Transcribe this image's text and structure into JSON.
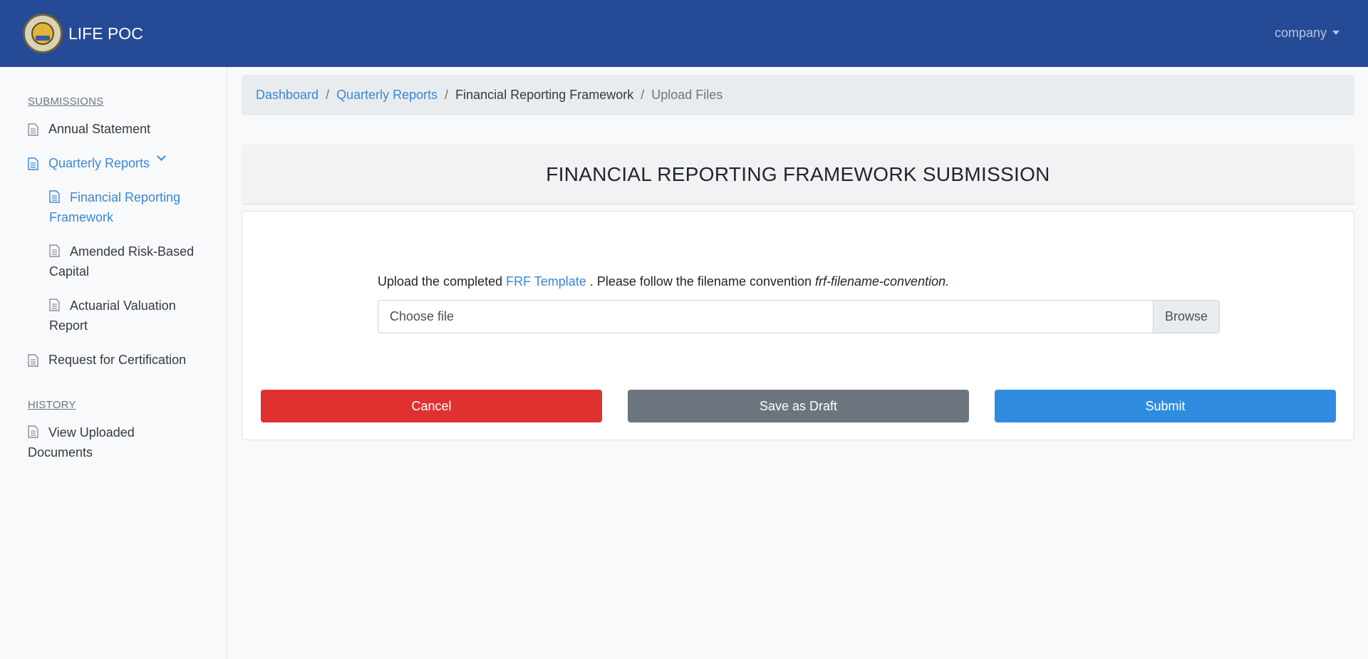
{
  "header": {
    "brand": "LIFE POC",
    "user_menu": "company"
  },
  "sidebar": {
    "submissions_heading": "SUBMISSIONS",
    "items": [
      {
        "label": "Annual Statement"
      },
      {
        "label": "Quarterly Reports"
      },
      {
        "label": "Financial Reporting Framework"
      },
      {
        "label": "Amended Risk-Based Capital"
      },
      {
        "label": "Actuarial Valuation Report"
      },
      {
        "label": "Request for Certification"
      }
    ],
    "history_heading": "HISTORY",
    "history_items": [
      {
        "label": "View Uploaded Documents"
      }
    ]
  },
  "breadcrumb": {
    "items": [
      "Dashboard",
      "Quarterly Reports",
      "Financial Reporting Framework",
      "Upload Files"
    ]
  },
  "main": {
    "title": "FINANCIAL REPORTING FRAMEWORK SUBMISSION",
    "instruction_prefix": "Upload the completed ",
    "template_link": "FRF Template",
    "instruction_middle": " . Please follow the filename convention ",
    "filename_convention": "frf-filename-convention.",
    "file_placeholder": "Choose file",
    "browse_label": "Browse",
    "cancel_label": "Cancel",
    "draft_label": "Save as Draft",
    "submit_label": "Submit"
  },
  "colors": {
    "topbar": "#254a96",
    "accent": "#3a87d6",
    "cancel": "#e03131",
    "draft": "#6c757d",
    "submit": "#2f8ce0"
  }
}
